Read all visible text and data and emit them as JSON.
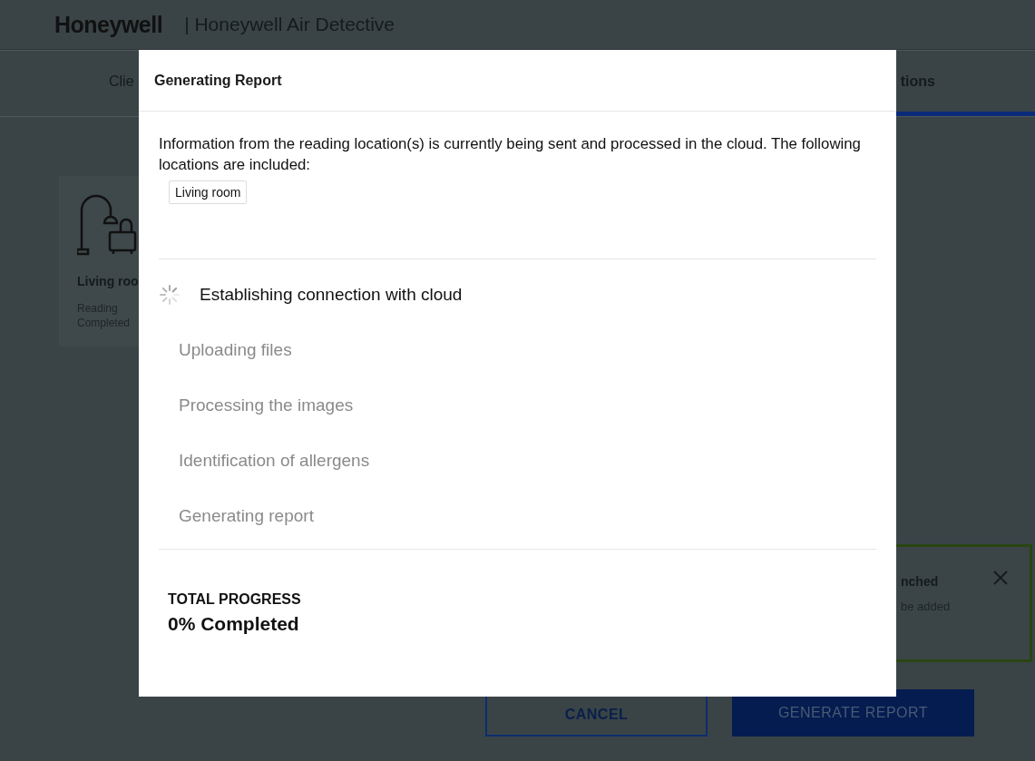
{
  "header": {
    "logo": "Honeywell",
    "app_title": "| Honeywell Air Detective"
  },
  "tabs": [
    {
      "label": "Clie",
      "selected": false
    },
    {
      "label": "tions",
      "selected": true
    }
  ],
  "location_card": {
    "name": "Living roo",
    "status": "Reading Completed"
  },
  "toast": {
    "title": "nched",
    "message": "be added"
  },
  "buttons": {
    "cancel": "CANCEL",
    "generate": "GENERATE REPORT"
  },
  "dialog": {
    "title": "Generating Report",
    "intro": "Information from the reading location(s) is currently being sent and processed in the cloud. The following locations are included:",
    "locations": [
      "Living room"
    ],
    "steps": [
      {
        "label": "Establishing connection with cloud",
        "active": true
      },
      {
        "label": "Uploading files",
        "active": false
      },
      {
        "label": "Processing the images",
        "active": false
      },
      {
        "label": "Identification of allergens",
        "active": false
      },
      {
        "label": "Generating report",
        "active": false
      }
    ],
    "progress_label": "TOTAL PROGRESS",
    "progress_value": "0% Completed"
  }
}
